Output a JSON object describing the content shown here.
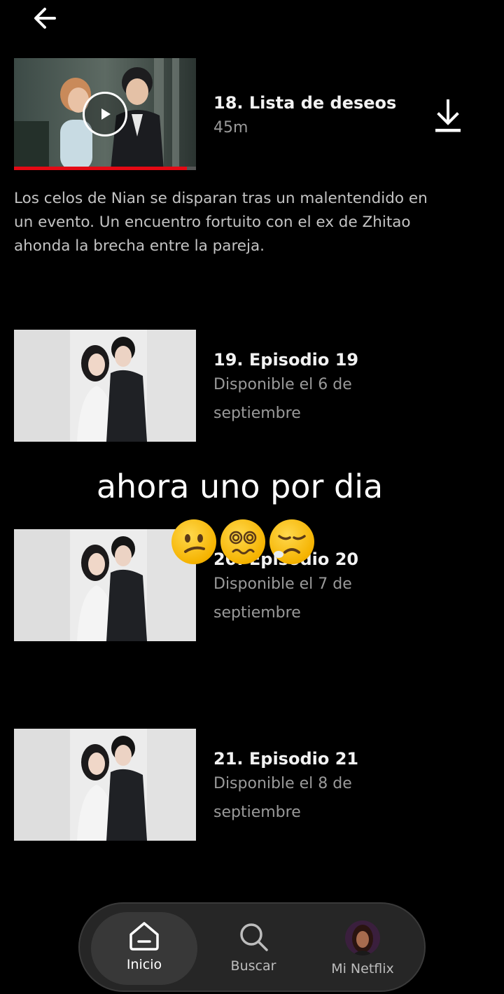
{
  "header": {
    "back_icon": "arrow-left-icon"
  },
  "episodes": [
    {
      "title": "18. Lista de deseos",
      "subtitle": "45m",
      "description": "Los celos de Nian se disparan tras un malentendido en un evento. Un encuentro fortuito con el ex de Zhitao ahonda la brecha entre la pareja.",
      "progress": 0.95,
      "icon": "download-icon"
    },
    {
      "title": "19. Episodio 19",
      "subtitle": "Disponible el 6 de septiembre"
    },
    {
      "title": "20. Episodio 20",
      "subtitle": "Disponible el 7 de septiembre"
    },
    {
      "title": "21. Episodio 21",
      "subtitle": "Disponible el 8 de septiembre"
    }
  ],
  "overlay": {
    "caption": "ahora uno por dia",
    "emojis": [
      "confused-face-emoji",
      "face-with-spiral-eyes-emoji",
      "tired-face-emoji"
    ]
  },
  "nav": {
    "items": [
      {
        "label": "Inicio",
        "icon": "home-icon",
        "active": true
      },
      {
        "label": "Buscar",
        "icon": "search-icon",
        "active": false
      },
      {
        "label": "Mi Netflix",
        "icon": "profile-avatar",
        "active": false
      }
    ]
  },
  "colors": {
    "accent": "#e50914",
    "background": "#000000",
    "nav_background": "#262626"
  }
}
